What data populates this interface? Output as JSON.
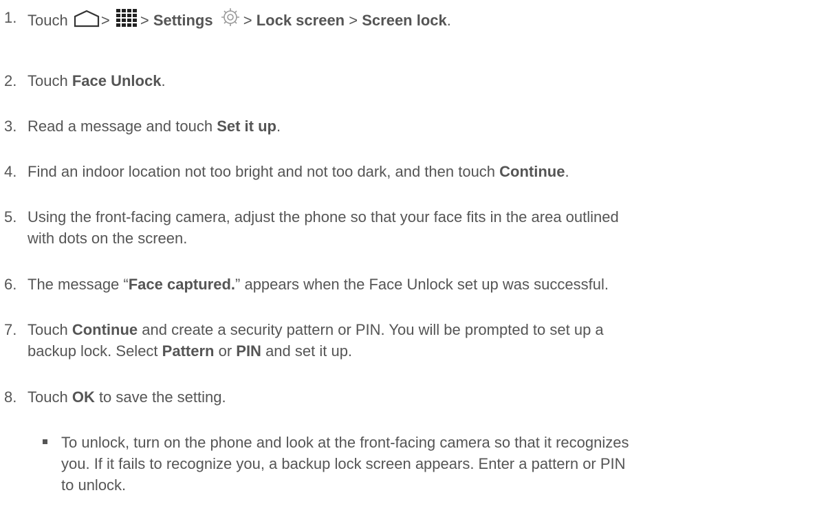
{
  "steps": [
    {
      "num": "1.",
      "parts": {
        "t1": "Touch",
        "sep1": ">",
        "sep2": ">",
        "settings": "Settings",
        "sep3": ">",
        "lock_screen": "Lock screen",
        "sep4": ">",
        "screen_lock": "Screen lock",
        "end": "."
      },
      "icons": [
        "home-icon",
        "apps-grid-icon",
        "settings-gear-icon"
      ]
    },
    {
      "num": "2.",
      "parts": {
        "t1": "Touch ",
        "b1": "Face Unlock",
        "t2": "."
      }
    },
    {
      "num": "3.",
      "parts": {
        "t1": "Read a message and touch ",
        "b1": "Set it up",
        "t2": "."
      }
    },
    {
      "num": "4.",
      "parts": {
        "t1": "Find an indoor location not too bright and not too dark, and then touch ",
        "b1": "Continue",
        "t2": "."
      }
    },
    {
      "num": "5.",
      "parts": {
        "line1": "Using the front-facing camera, adjust the phone so that your face fits in the area outlined",
        "line2": "with dots on the screen."
      }
    },
    {
      "num": "6.",
      "parts": {
        "t1": "The message “",
        "b1": "Face captured.",
        "t2": "” appears when the Face Unlock set up was successful."
      }
    },
    {
      "num": "7.",
      "parts": {
        "t1": "Touch ",
        "b1": "Continue",
        "t2": " and create a security pattern or PIN. You will be prompted to set up a",
        "t3": "backup lock. Select ",
        "b2": "Pattern",
        "t4": " or ",
        "b3": "PIN",
        "t5": " and set it up."
      }
    },
    {
      "num": "8.",
      "parts": {
        "t1": "Touch ",
        "b1": "OK",
        "t2": " to save the setting."
      }
    }
  ],
  "note": {
    "line1": "To unlock, turn on the phone and look at the front-facing camera so that it recognizes",
    "line2": "you. If it fails to recognize you, a backup lock screen appears. Enter a pattern or PIN",
    "line3": "to unlock."
  },
  "colors": {
    "text": "#555555",
    "background": "#ffffff"
  }
}
